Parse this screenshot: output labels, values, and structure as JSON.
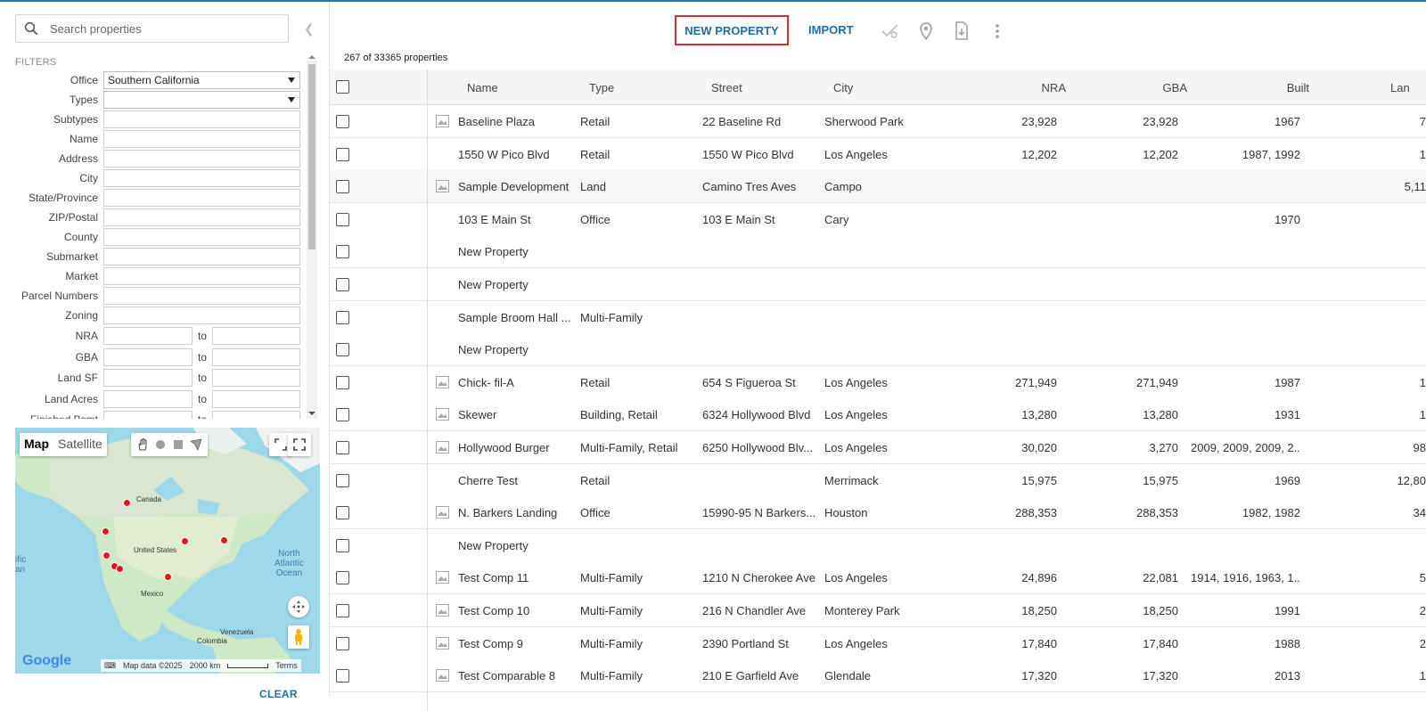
{
  "search": {
    "placeholder": "Search properties"
  },
  "filters": {
    "title": "FILTERS",
    "office": {
      "label": "Office",
      "value": "Southern California"
    },
    "types": {
      "label": "Types",
      "value": ""
    },
    "fields": [
      "Subtypes",
      "Name",
      "Address",
      "City",
      "State/Province",
      "ZIP/Postal",
      "County",
      "Submarket",
      "Market",
      "Parcel Numbers",
      "Zoning"
    ],
    "ranges": [
      "NRA",
      "GBA",
      "Land SF",
      "Land Acres",
      "Finished Bsmt"
    ],
    "range_to": "to",
    "clear_label": "CLEAR"
  },
  "map": {
    "map_label": "Map",
    "satellite_label": "Satellite",
    "labels": {
      "canada": "Canada",
      "us": "United States",
      "mexico": "Mexico",
      "venezuela": "Venezuela",
      "colombia": "Colombia"
    },
    "ocean_lines": [
      "North",
      "Atlantic",
      "Ocean"
    ],
    "left_edge_lines": [
      "ific",
      "an"
    ],
    "google": "Google",
    "footer": {
      "data": "Map data ©2025",
      "scale": "2000 km",
      "terms": "Terms"
    }
  },
  "toolbar": {
    "new_property": "NEW PROPERTY",
    "import": "IMPORT",
    "icons": [
      "visibility-off-icon",
      "map-pin-icon",
      "download-icon",
      "more-vert-icon"
    ]
  },
  "count_text": "267 of 33365 properties",
  "grid": {
    "headers": {
      "name": "Name",
      "type": "Type",
      "street": "Street",
      "city": "City",
      "nra": "NRA",
      "gba": "GBA",
      "built": "Built",
      "land": "Lan"
    },
    "rows": [
      {
        "thumb": true,
        "name": "Baseline Plaza",
        "type": "Retail",
        "street": "22 Baseline Rd",
        "city": "Sherwood Park",
        "nra": "23,928",
        "gba": "23,928",
        "built": "1967",
        "land": "7"
      },
      {
        "thumb": false,
        "name": "1550 W Pico Blvd",
        "type": "Retail",
        "street": "1550 W Pico Blvd",
        "city": "Los Angeles",
        "nra": "12,202",
        "gba": "12,202",
        "built": "1987, 1992",
        "land": "1"
      },
      {
        "thumb": true,
        "name": "Sample Development",
        "type": "Land",
        "street": "Camino Tres Aves",
        "city": "Campo",
        "nra": "",
        "gba": "",
        "built": "",
        "land": "5,11"
      },
      {
        "thumb": false,
        "name": "103 E Main St",
        "type": "Office",
        "street": "103 E Main St",
        "city": "Cary",
        "nra": "",
        "gba": "",
        "built": "1970",
        "land": ""
      },
      {
        "thumb": false,
        "name": "New Property",
        "type": "",
        "street": "",
        "city": "",
        "nra": "",
        "gba": "",
        "built": "",
        "land": ""
      },
      {
        "thumb": false,
        "name": "New Property",
        "type": "",
        "street": "",
        "city": "",
        "nra": "",
        "gba": "",
        "built": "",
        "land": ""
      },
      {
        "thumb": false,
        "name": "Sample Broom Hall ...",
        "type": "Multi-Family",
        "street": "",
        "city": "",
        "nra": "",
        "gba": "",
        "built": "",
        "land": ""
      },
      {
        "thumb": false,
        "name": "New Property",
        "type": "",
        "street": "",
        "city": "",
        "nra": "",
        "gba": "",
        "built": "",
        "land": ""
      },
      {
        "thumb": true,
        "name": "Chick- fil-A",
        "type": "Retail",
        "street": "654 S Figueroa St",
        "city": "Los Angeles",
        "nra": "271,949",
        "gba": "271,949",
        "built": "1987",
        "land": "1"
      },
      {
        "thumb": true,
        "name": "Skewer",
        "type": "Building, Retail",
        "street": "6324 Hollywood Blvd",
        "city": "Los Angeles",
        "nra": "13,280",
        "gba": "13,280",
        "built": "1931",
        "land": "1"
      },
      {
        "thumb": true,
        "name": "Hollywood Burger",
        "type": "Multi-Family, Retail",
        "street": "6250 Hollywood Blv...",
        "city": "Los Angeles",
        "nra": "30,020",
        "gba": "3,270",
        "built": "2009, 2009, 2009, 2...",
        "land": "98"
      },
      {
        "thumb": false,
        "name": "Cherre Test",
        "type": "Retail",
        "street": "",
        "city": "Merrimack",
        "nra": "15,975",
        "gba": "15,975",
        "built": "1969",
        "land": "12,80"
      },
      {
        "thumb": true,
        "name": "N. Barkers Landing",
        "type": "Office",
        "street": "15990-95 N Barkers...",
        "city": "Houston",
        "nra": "288,353",
        "gba": "288,353",
        "built": "1982, 1982",
        "land": "34"
      },
      {
        "thumb": false,
        "name": "New Property",
        "type": "",
        "street": "",
        "city": "",
        "nra": "",
        "gba": "",
        "built": "",
        "land": ""
      },
      {
        "thumb": true,
        "name": "Test Comp 11",
        "type": "Multi-Family",
        "street": "1210 N Cherokee Ave",
        "city": "Los Angeles",
        "nra": "24,896",
        "gba": "22,081",
        "built": "1914, 1916, 1963, 1...",
        "land": "5"
      },
      {
        "thumb": true,
        "name": "Test Comp 10",
        "type": "Multi-Family",
        "street": "216 N Chandler Ave",
        "city": "Monterey Park",
        "nra": "18,250",
        "gba": "18,250",
        "built": "1991",
        "land": "2"
      },
      {
        "thumb": true,
        "name": "Test Comp 9",
        "type": "Multi-Family",
        "street": "2390 Portland St",
        "city": "Los Angeles",
        "nra": "17,840",
        "gba": "17,840",
        "built": "1988",
        "land": "2"
      },
      {
        "thumb": true,
        "name": "Test Comparable 8",
        "type": "Multi-Family",
        "street": "210 E Garfield Ave",
        "city": "Glendale",
        "nra": "17,320",
        "gba": "17,320",
        "built": "2013",
        "land": "1"
      }
    ]
  },
  "colors": {
    "accent": "#1d6fa5",
    "highlight_border": "#d32f2f",
    "pin": "#e8161b",
    "map_water": "#9dd9e8"
  }
}
